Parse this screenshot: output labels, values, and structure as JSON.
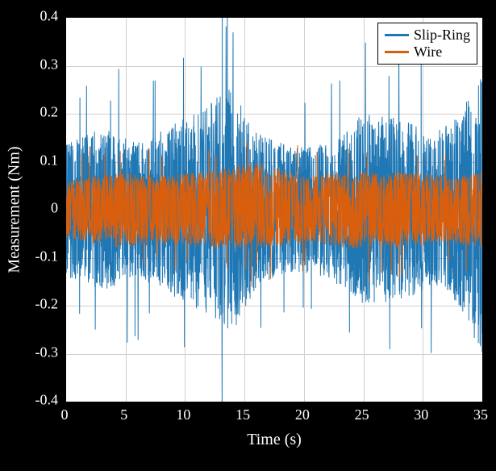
{
  "chart_data": {
    "type": "line",
    "title": "",
    "xlabel": "Time (s)",
    "ylabel": "Measurement (Nm)",
    "xlim": [
      0,
      35
    ],
    "ylim": [
      -0.4,
      0.4
    ],
    "x_ticks": [
      0,
      5,
      10,
      15,
      20,
      25,
      30,
      35
    ],
    "y_ticks": [
      -0.4,
      -0.3,
      -0.2,
      -0.1,
      0,
      0.1,
      0.2,
      0.3,
      0.4
    ],
    "legend_position": "top-right",
    "grid": true,
    "series": [
      {
        "name": "Slip-Ring",
        "color": "#1f77b4",
        "note": "Dense noisy signal oscillating roughly between -0.2 Nm and +0.2 Nm with occasional spikes reaching about ±0.3 Nm and slight amplitude modulation over the 0–35 s window.",
        "envelope": [
          {
            "t": 0,
            "hi": 0.14,
            "lo": -0.14
          },
          {
            "t": 3,
            "hi": 0.17,
            "lo": -0.17
          },
          {
            "t": 6,
            "hi": 0.14,
            "lo": -0.14
          },
          {
            "t": 9,
            "hi": 0.18,
            "lo": -0.18
          },
          {
            "t": 12,
            "hi": 0.22,
            "lo": -0.22
          },
          {
            "t": 14,
            "hi": 0.26,
            "lo": -0.26
          },
          {
            "t": 16,
            "hi": 0.16,
            "lo": -0.16
          },
          {
            "t": 19,
            "hi": 0.13,
            "lo": -0.13
          },
          {
            "t": 22,
            "hi": 0.14,
            "lo": -0.14
          },
          {
            "t": 25,
            "hi": 0.2,
            "lo": -0.2
          },
          {
            "t": 28,
            "hi": 0.19,
            "lo": -0.19
          },
          {
            "t": 31,
            "hi": 0.16,
            "lo": -0.16
          },
          {
            "t": 33,
            "hi": 0.2,
            "lo": -0.2
          },
          {
            "t": 35,
            "hi": 0.28,
            "lo": -0.32
          }
        ]
      },
      {
        "name": "Wire",
        "color": "#d95f0e",
        "note": "Dense noisy signal centered on 0, amplitude roughly half of Slip-Ring, mostly within ±0.08 Nm, occasional spikes near ±0.12 Nm.",
        "envelope": [
          {
            "t": 0,
            "hi": 0.06,
            "lo": -0.06
          },
          {
            "t": 4,
            "hi": 0.08,
            "lo": -0.08
          },
          {
            "t": 8,
            "hi": 0.07,
            "lo": -0.07
          },
          {
            "t": 12,
            "hi": 0.08,
            "lo": -0.08
          },
          {
            "t": 16,
            "hi": 0.1,
            "lo": -0.08
          },
          {
            "t": 20,
            "hi": 0.07,
            "lo": -0.07
          },
          {
            "t": 24,
            "hi": 0.08,
            "lo": -0.08
          },
          {
            "t": 28,
            "hi": 0.08,
            "lo": -0.08
          },
          {
            "t": 32,
            "hi": 0.07,
            "lo": -0.07
          },
          {
            "t": 35,
            "hi": 0.08,
            "lo": -0.08
          }
        ]
      }
    ]
  }
}
